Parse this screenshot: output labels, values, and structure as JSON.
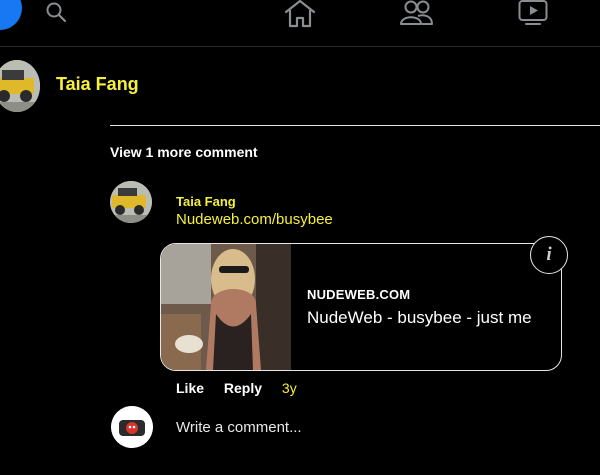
{
  "nav": {
    "icons": [
      "facebook-logo-icon",
      "search-icon",
      "home-icon",
      "friends-icon",
      "watch-icon"
    ]
  },
  "post": {
    "author_name": "Taia Fang"
  },
  "comments": {
    "view_more_label": "View 1 more comment",
    "comment": {
      "author": "Taia Fang",
      "text": "Nudeweb.com/busybee",
      "link_preview": {
        "domain": "NUDEWEB.COM",
        "title": "NudeWeb - busybee - just me"
      },
      "actions": {
        "like_label": "Like",
        "reply_label": "Reply",
        "time": "3y"
      }
    },
    "composer": {
      "placeholder": "Write a comment..."
    }
  },
  "colors": {
    "background": "#000000",
    "name_yellow": "#f6ef3b",
    "facebook_blue": "#1877f2",
    "text": "#ffffff"
  }
}
